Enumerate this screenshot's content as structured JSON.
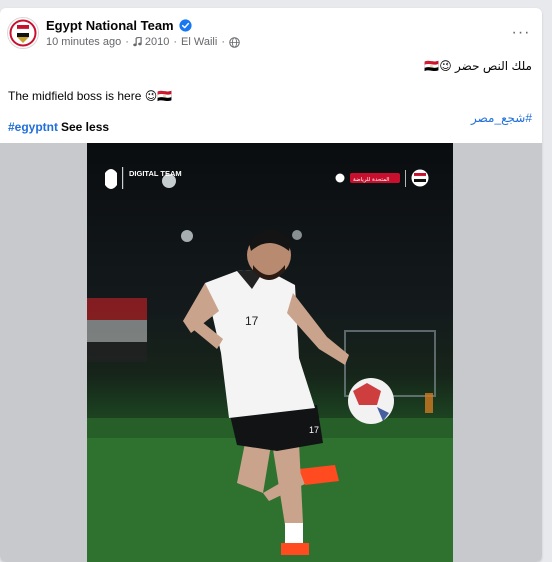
{
  "post": {
    "page_name": "Egypt National Team",
    "time_ago": "10 minutes ago",
    "music": "2010",
    "location": "El Waili",
    "caption_arabic": "ملك النص حضر 😉🇪🇬",
    "caption_english": "The midfield boss is here 😉🇪🇬",
    "hashtag_arabic": "#شجع_مصر",
    "hashtag_english": "#egyptnt",
    "see_less": "See less",
    "more_label": "···"
  },
  "photo": {
    "brand_left": "DIGITAL TEAM",
    "brand_right_label": "المتحدة للرياضة",
    "jersey_number": "17",
    "short_number": "17"
  },
  "colors": {
    "link_blue": "#216fdb",
    "verified_blue": "#1877f2",
    "pitch_green": "#2a6a2c",
    "boot_orange": "#ff4b1f"
  },
  "icons": [
    "verified-badge-icon",
    "music-note-icon",
    "globe-icon",
    "more-options-icon"
  ]
}
